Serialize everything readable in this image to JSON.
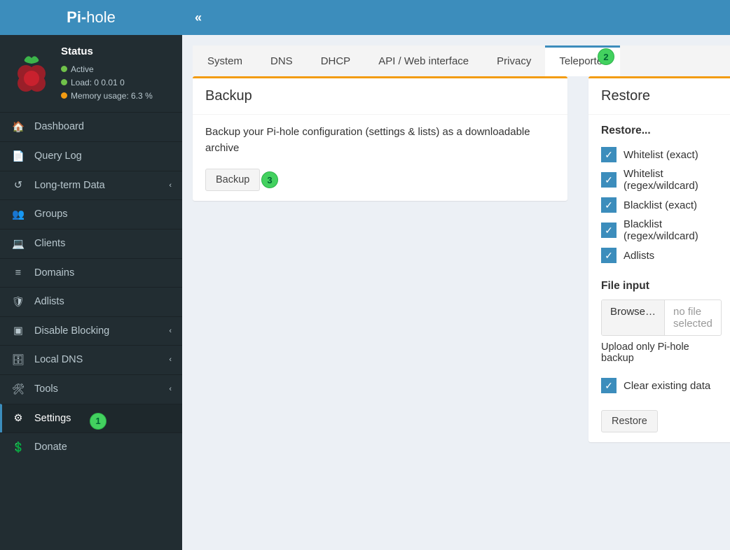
{
  "brand": {
    "bold": "Pi-",
    "thin": "hole"
  },
  "status": {
    "title": "Status",
    "active": "Active",
    "load_label": "Load:",
    "load_value": "0  0.01  0",
    "mem_label": "Memory usage:",
    "mem_value": "6.3 %"
  },
  "nav": {
    "dashboard": "Dashboard",
    "querylog": "Query Log",
    "longterm": "Long-term Data",
    "groups": "Groups",
    "clients": "Clients",
    "domains": "Domains",
    "adlists": "Adlists",
    "disable": "Disable Blocking",
    "localdns": "Local DNS",
    "tools": "Tools",
    "settings": "Settings",
    "donate": "Donate"
  },
  "tabs": {
    "system": "System",
    "dns": "DNS",
    "dhcp": "DHCP",
    "api": "API / Web interface",
    "privacy": "Privacy",
    "teleporter": "Teleporter"
  },
  "backup": {
    "title": "Backup",
    "desc": "Backup your Pi-hole configuration (settings & lists) as a downloadable archive",
    "button": "Backup"
  },
  "restore": {
    "title": "Restore",
    "subtitle": "Restore...",
    "items": {
      "w_exact": "Whitelist (exact)",
      "w_regex": "Whitelist (regex/wildcard)",
      "b_exact": "Blacklist (exact)",
      "b_regex": "Blacklist (regex/wildcard)",
      "adlists": "Adlists"
    },
    "file_label": "File input",
    "browse": "Browse…",
    "nofile": "no file selected",
    "hint": "Upload only Pi-hole backup",
    "clear": "Clear existing data",
    "button": "Restore"
  },
  "annotations": {
    "a1": "1",
    "a2": "2",
    "a3": "3"
  }
}
